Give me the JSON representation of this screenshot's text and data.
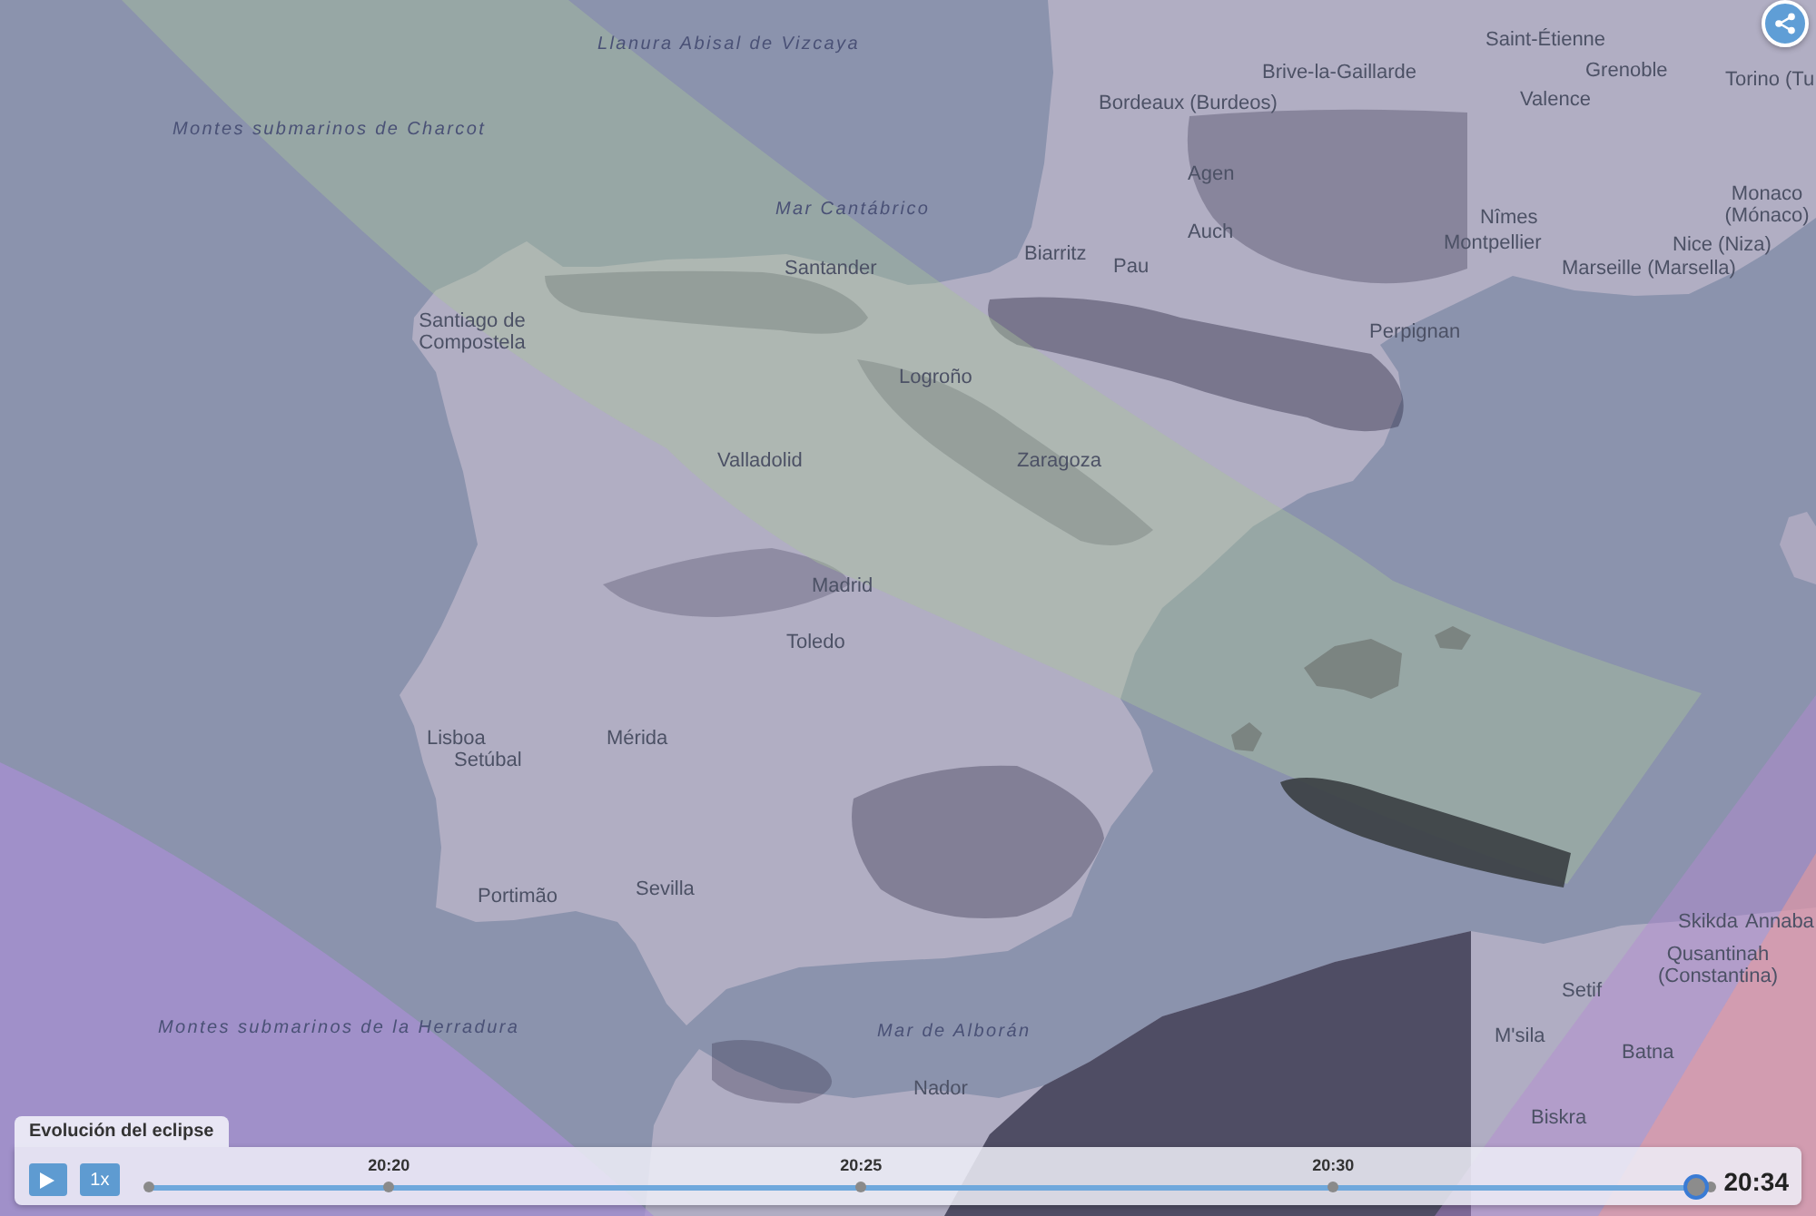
{
  "map": {
    "labels": [
      {
        "text": "Llanura Abisal de Vizcaya",
        "kind": "sea"
      },
      {
        "text": "Montes submarinos de Charcot",
        "kind": "sea"
      },
      {
        "text": "Mar Cantábrico",
        "kind": "sea"
      },
      {
        "text": "Saint-Étienne",
        "kind": "city"
      },
      {
        "text": "Brive-la-Gaillarde",
        "kind": "city"
      },
      {
        "text": "Grenoble",
        "kind": "city"
      },
      {
        "text": "Torino (Tu",
        "kind": "city"
      },
      {
        "text": "Bordeaux (Burdeos)",
        "kind": "city"
      },
      {
        "text": "Valence",
        "kind": "city"
      },
      {
        "text": "Monaco (Mónaco)",
        "kind": "city"
      },
      {
        "text": "Agen",
        "kind": "city"
      },
      {
        "text": "Auch",
        "kind": "city"
      },
      {
        "text": "Nîmes",
        "kind": "city"
      },
      {
        "text": "Montpellier",
        "kind": "city"
      },
      {
        "text": "Nice (Niza)",
        "kind": "city"
      },
      {
        "text": "Santander",
        "kind": "city"
      },
      {
        "text": "Biarritz",
        "kind": "city"
      },
      {
        "text": "Pau",
        "kind": "city"
      },
      {
        "text": "Marseille (Marsella)",
        "kind": "city"
      },
      {
        "text": "Santiago de Compostela",
        "kind": "city"
      },
      {
        "text": "Perpignan",
        "kind": "city"
      },
      {
        "text": "Logroño",
        "kind": "city"
      },
      {
        "text": "Valladolid",
        "kind": "city"
      },
      {
        "text": "Zaragoza",
        "kind": "city"
      },
      {
        "text": "Madrid",
        "kind": "city"
      },
      {
        "text": "Toledo",
        "kind": "city"
      },
      {
        "text": "Lisboa",
        "kind": "city"
      },
      {
        "text": "Setúbal",
        "kind": "city"
      },
      {
        "text": "Mérida",
        "kind": "city"
      },
      {
        "text": "Portimão",
        "kind": "city"
      },
      {
        "text": "Sevilla",
        "kind": "city"
      },
      {
        "text": "Montes submarinos de la Herradura",
        "kind": "sea"
      },
      {
        "text": "Mar de Alborán",
        "kind": "sea"
      },
      {
        "text": "Nador",
        "kind": "city"
      },
      {
        "text": "Skikda",
        "kind": "city"
      },
      {
        "text": "Annaba",
        "kind": "city"
      },
      {
        "text": "Qusantinah (Constantina)",
        "kind": "city"
      },
      {
        "text": "Setif",
        "kind": "city"
      },
      {
        "text": "M'sila",
        "kind": "city"
      },
      {
        "text": "Batna",
        "kind": "city"
      },
      {
        "text": "Biskra",
        "kind": "city"
      }
    ]
  },
  "player": {
    "title": "Evolución del eclipse",
    "playing": false,
    "speed": "1x",
    "ticks": [
      "20:20",
      "20:25",
      "20:30"
    ],
    "level": 0.99,
    "time": "20:34"
  }
}
